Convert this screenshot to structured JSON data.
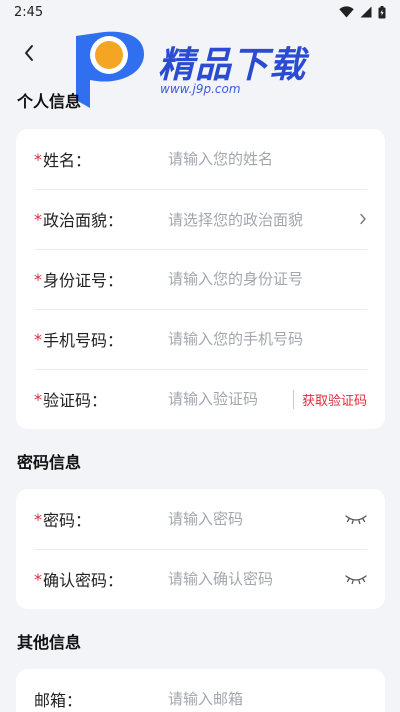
{
  "status_bar": {
    "time": "2:45"
  },
  "watermark": {
    "title": "精品下载",
    "url": "www.j9p.com"
  },
  "sections": {
    "personal": {
      "title": "个人信息",
      "name": {
        "label": "姓名：",
        "placeholder": "请输入您的姓名"
      },
      "political": {
        "label": "政治面貌：",
        "placeholder": "请选择您的政治面貌"
      },
      "id_number": {
        "label": "身份证号：",
        "placeholder": "请输入您的身份证号"
      },
      "phone": {
        "label": "手机号码：",
        "placeholder": "请输入您的手机号码"
      },
      "code": {
        "label": "验证码：",
        "placeholder": "请输入验证码",
        "button": "获取验证码"
      }
    },
    "password": {
      "title": "密码信息",
      "password": {
        "label": "密码：",
        "placeholder": "请输入密码"
      },
      "confirm": {
        "label": "确认密码：",
        "placeholder": "请输入确认密码"
      }
    },
    "other": {
      "title": "其他信息",
      "email": {
        "label": "邮箱：",
        "placeholder": "请输入邮箱"
      }
    }
  },
  "required_mark": "*",
  "colors": {
    "accent": "#e0283a",
    "watermark_blue": "#2b4bd3",
    "background": "#f3f4f8"
  },
  "icons": {
    "back": "chevron-left-icon",
    "select": "chevron-right-icon",
    "eye": "eye-closed-icon",
    "wifi": "wifi-icon",
    "signal": "signal-icon",
    "battery": "battery-icon"
  }
}
